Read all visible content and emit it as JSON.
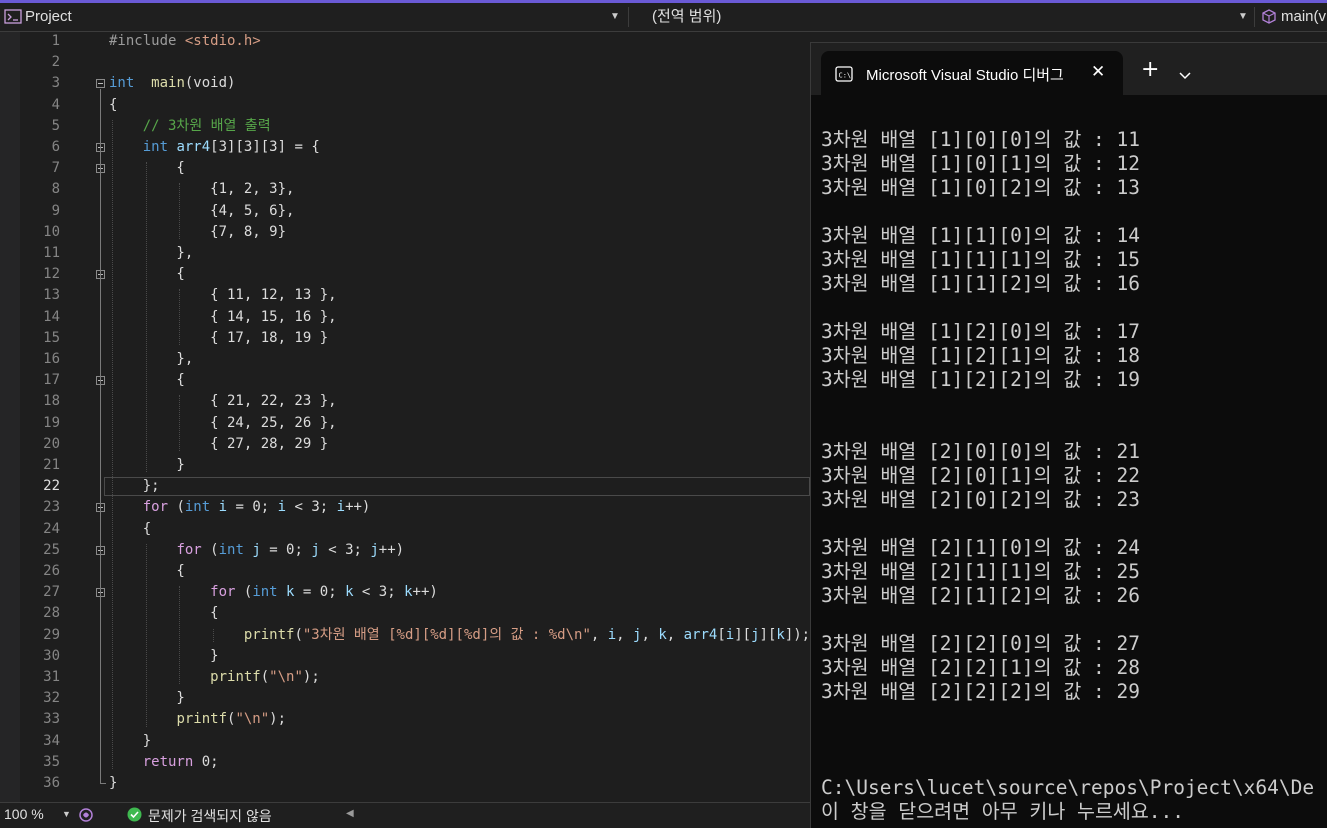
{
  "nav": {
    "project": "Project",
    "scope": "(전역 범위)",
    "function": "main(v"
  },
  "editor": {
    "current_line": 22,
    "lines": [
      {
        "n": "1",
        "t": [
          [
            "pp",
            "#include "
          ],
          [
            "inc",
            "<stdio.h>"
          ]
        ]
      },
      {
        "n": "2",
        "t": []
      },
      {
        "n": "3",
        "t": [
          [
            "kw",
            "int"
          ],
          [
            "",
            "  "
          ],
          [
            "fn",
            "main"
          ],
          [
            "",
            "(void)"
          ]
        ]
      },
      {
        "n": "4",
        "t": [
          [
            "",
            "{"
          ]
        ]
      },
      {
        "n": "5",
        "t": [
          [
            "",
            "    "
          ],
          [
            "cm",
            "// 3차원 배열 출력"
          ]
        ]
      },
      {
        "n": "6",
        "t": [
          [
            "",
            "    "
          ],
          [
            "kw",
            "int"
          ],
          [
            "",
            ""
          ],
          [
            "var",
            " arr4"
          ],
          [
            "",
            "[3][3][3] = {"
          ]
        ]
      },
      {
        "n": "7",
        "t": [
          [
            "",
            "        {"
          ]
        ]
      },
      {
        "n": "8",
        "t": [
          [
            "",
            "            {1, 2, 3},"
          ]
        ]
      },
      {
        "n": "9",
        "t": [
          [
            "",
            "            {4, 5, 6},"
          ]
        ]
      },
      {
        "n": "10",
        "t": [
          [
            "",
            "            {7, 8, 9}"
          ]
        ]
      },
      {
        "n": "11",
        "t": [
          [
            "",
            "        },"
          ]
        ]
      },
      {
        "n": "12",
        "t": [
          [
            "",
            "        {"
          ]
        ]
      },
      {
        "n": "13",
        "t": [
          [
            "",
            "            { 11, 12, 13 },"
          ]
        ]
      },
      {
        "n": "14",
        "t": [
          [
            "",
            "            { 14, 15, 16 },"
          ]
        ]
      },
      {
        "n": "15",
        "t": [
          [
            "",
            "            { 17, 18, 19 }"
          ]
        ]
      },
      {
        "n": "16",
        "t": [
          [
            "",
            "        },"
          ]
        ]
      },
      {
        "n": "17",
        "t": [
          [
            "",
            "        {"
          ]
        ]
      },
      {
        "n": "18",
        "t": [
          [
            "",
            "            { 21, 22, 23 },"
          ]
        ]
      },
      {
        "n": "19",
        "t": [
          [
            "",
            "            { 24, 25, 26 },"
          ]
        ]
      },
      {
        "n": "20",
        "t": [
          [
            "",
            "            { 27, 28, 29 }"
          ]
        ]
      },
      {
        "n": "21",
        "t": [
          [
            "",
            "        }"
          ]
        ]
      },
      {
        "n": "22",
        "t": [
          [
            "",
            "    };"
          ]
        ]
      },
      {
        "n": "23",
        "t": [
          [
            "",
            "    "
          ],
          [
            "ctl",
            "for"
          ],
          [
            "",
            " ("
          ],
          [
            "kw",
            "int"
          ],
          [
            "",
            " "
          ],
          [
            "var",
            "i"
          ],
          [
            "",
            " = 0; "
          ],
          [
            "var",
            "i"
          ],
          [
            "",
            " < 3; "
          ],
          [
            "var",
            "i"
          ],
          [
            "",
            "++)"
          ]
        ]
      },
      {
        "n": "24",
        "t": [
          [
            "",
            "    {"
          ]
        ]
      },
      {
        "n": "25",
        "t": [
          [
            "",
            "        "
          ],
          [
            "ctl",
            "for"
          ],
          [
            "",
            " ("
          ],
          [
            "kw",
            "int"
          ],
          [
            "",
            " "
          ],
          [
            "var",
            "j"
          ],
          [
            "",
            " = 0; "
          ],
          [
            "var",
            "j"
          ],
          [
            "",
            " < 3; "
          ],
          [
            "var",
            "j"
          ],
          [
            "",
            "++)"
          ]
        ]
      },
      {
        "n": "26",
        "t": [
          [
            "",
            "        {"
          ]
        ]
      },
      {
        "n": "27",
        "t": [
          [
            "",
            "            "
          ],
          [
            "ctl",
            "for"
          ],
          [
            "",
            " ("
          ],
          [
            "kw",
            "int"
          ],
          [
            "",
            " "
          ],
          [
            "var",
            "k"
          ],
          [
            "",
            " = 0; "
          ],
          [
            "var",
            "k"
          ],
          [
            "",
            " < 3; "
          ],
          [
            "var",
            "k"
          ],
          [
            "",
            "++)"
          ]
        ]
      },
      {
        "n": "28",
        "t": [
          [
            "",
            "            {"
          ]
        ]
      },
      {
        "n": "29",
        "t": [
          [
            "",
            "                "
          ],
          [
            "fn",
            "printf"
          ],
          [
            "",
            "("
          ],
          [
            "str",
            "\"3차원 배열 [%d][%d][%d]의 값 : %d\\n\""
          ],
          [
            "",
            ", "
          ],
          [
            "var",
            "i"
          ],
          [
            "",
            ", "
          ],
          [
            "var",
            "j"
          ],
          [
            "",
            ", "
          ],
          [
            "var",
            "k"
          ],
          [
            "",
            ", "
          ],
          [
            "var",
            "arr4"
          ],
          [
            "",
            "["
          ],
          [
            "var",
            "i"
          ],
          [
            "",
            "]["
          ],
          [
            "var",
            "j"
          ],
          [
            "",
            "]["
          ],
          [
            "var",
            "k"
          ],
          [
            "",
            "]);"
          ]
        ]
      },
      {
        "n": "30",
        "t": [
          [
            "",
            "            }"
          ]
        ]
      },
      {
        "n": "31",
        "t": [
          [
            "",
            "            "
          ],
          [
            "fn",
            "printf"
          ],
          [
            "",
            "("
          ],
          [
            "str",
            "\"\\n\""
          ],
          [
            "",
            ");"
          ]
        ]
      },
      {
        "n": "32",
        "t": [
          [
            "",
            "        }"
          ]
        ]
      },
      {
        "n": "33",
        "t": [
          [
            "",
            "        "
          ],
          [
            "fn",
            "printf"
          ],
          [
            "",
            "("
          ],
          [
            "str",
            "\"\\n\""
          ],
          [
            "",
            ");"
          ]
        ]
      },
      {
        "n": "34",
        "t": [
          [
            "",
            "    }"
          ]
        ]
      },
      {
        "n": "35",
        "t": [
          [
            "",
            "    "
          ],
          [
            "ctl",
            "return"
          ],
          [
            "",
            " 0;"
          ]
        ]
      },
      {
        "n": "36",
        "t": [
          [
            "",
            "}"
          ]
        ]
      }
    ]
  },
  "console": {
    "tab_title": "Microsoft Visual Studio 디버그",
    "new_tab": "+",
    "output": [
      "",
      "3차원 배열 [1][0][0]의 값 : 11",
      "3차원 배열 [1][0][1]의 값 : 12",
      "3차원 배열 [1][0][2]의 값 : 13",
      "",
      "3차원 배열 [1][1][0]의 값 : 14",
      "3차원 배열 [1][1][1]의 값 : 15",
      "3차원 배열 [1][1][2]의 값 : 16",
      "",
      "3차원 배열 [1][2][0]의 값 : 17",
      "3차원 배열 [1][2][1]의 값 : 18",
      "3차원 배열 [1][2][2]의 값 : 19",
      "",
      "",
      "3차원 배열 [2][0][0]의 값 : 21",
      "3차원 배열 [2][0][1]의 값 : 22",
      "3차원 배열 [2][0][2]의 값 : 23",
      "",
      "3차원 배열 [2][1][0]의 값 : 24",
      "3차원 배열 [2][1][1]의 값 : 25",
      "3차원 배열 [2][1][2]의 값 : 26",
      "",
      "3차원 배열 [2][2][0]의 값 : 27",
      "3차원 배열 [2][2][1]의 값 : 28",
      "3차원 배열 [2][2][2]의 값 : 29",
      "",
      "",
      "",
      "C:\\Users\\lucet\\source\\repos\\Project\\x64\\De",
      "이 창을 닫으려면 아무 키나 누르세요..."
    ]
  },
  "status": {
    "zoom": "100 %",
    "issues": "문제가 검색되지 않음"
  }
}
